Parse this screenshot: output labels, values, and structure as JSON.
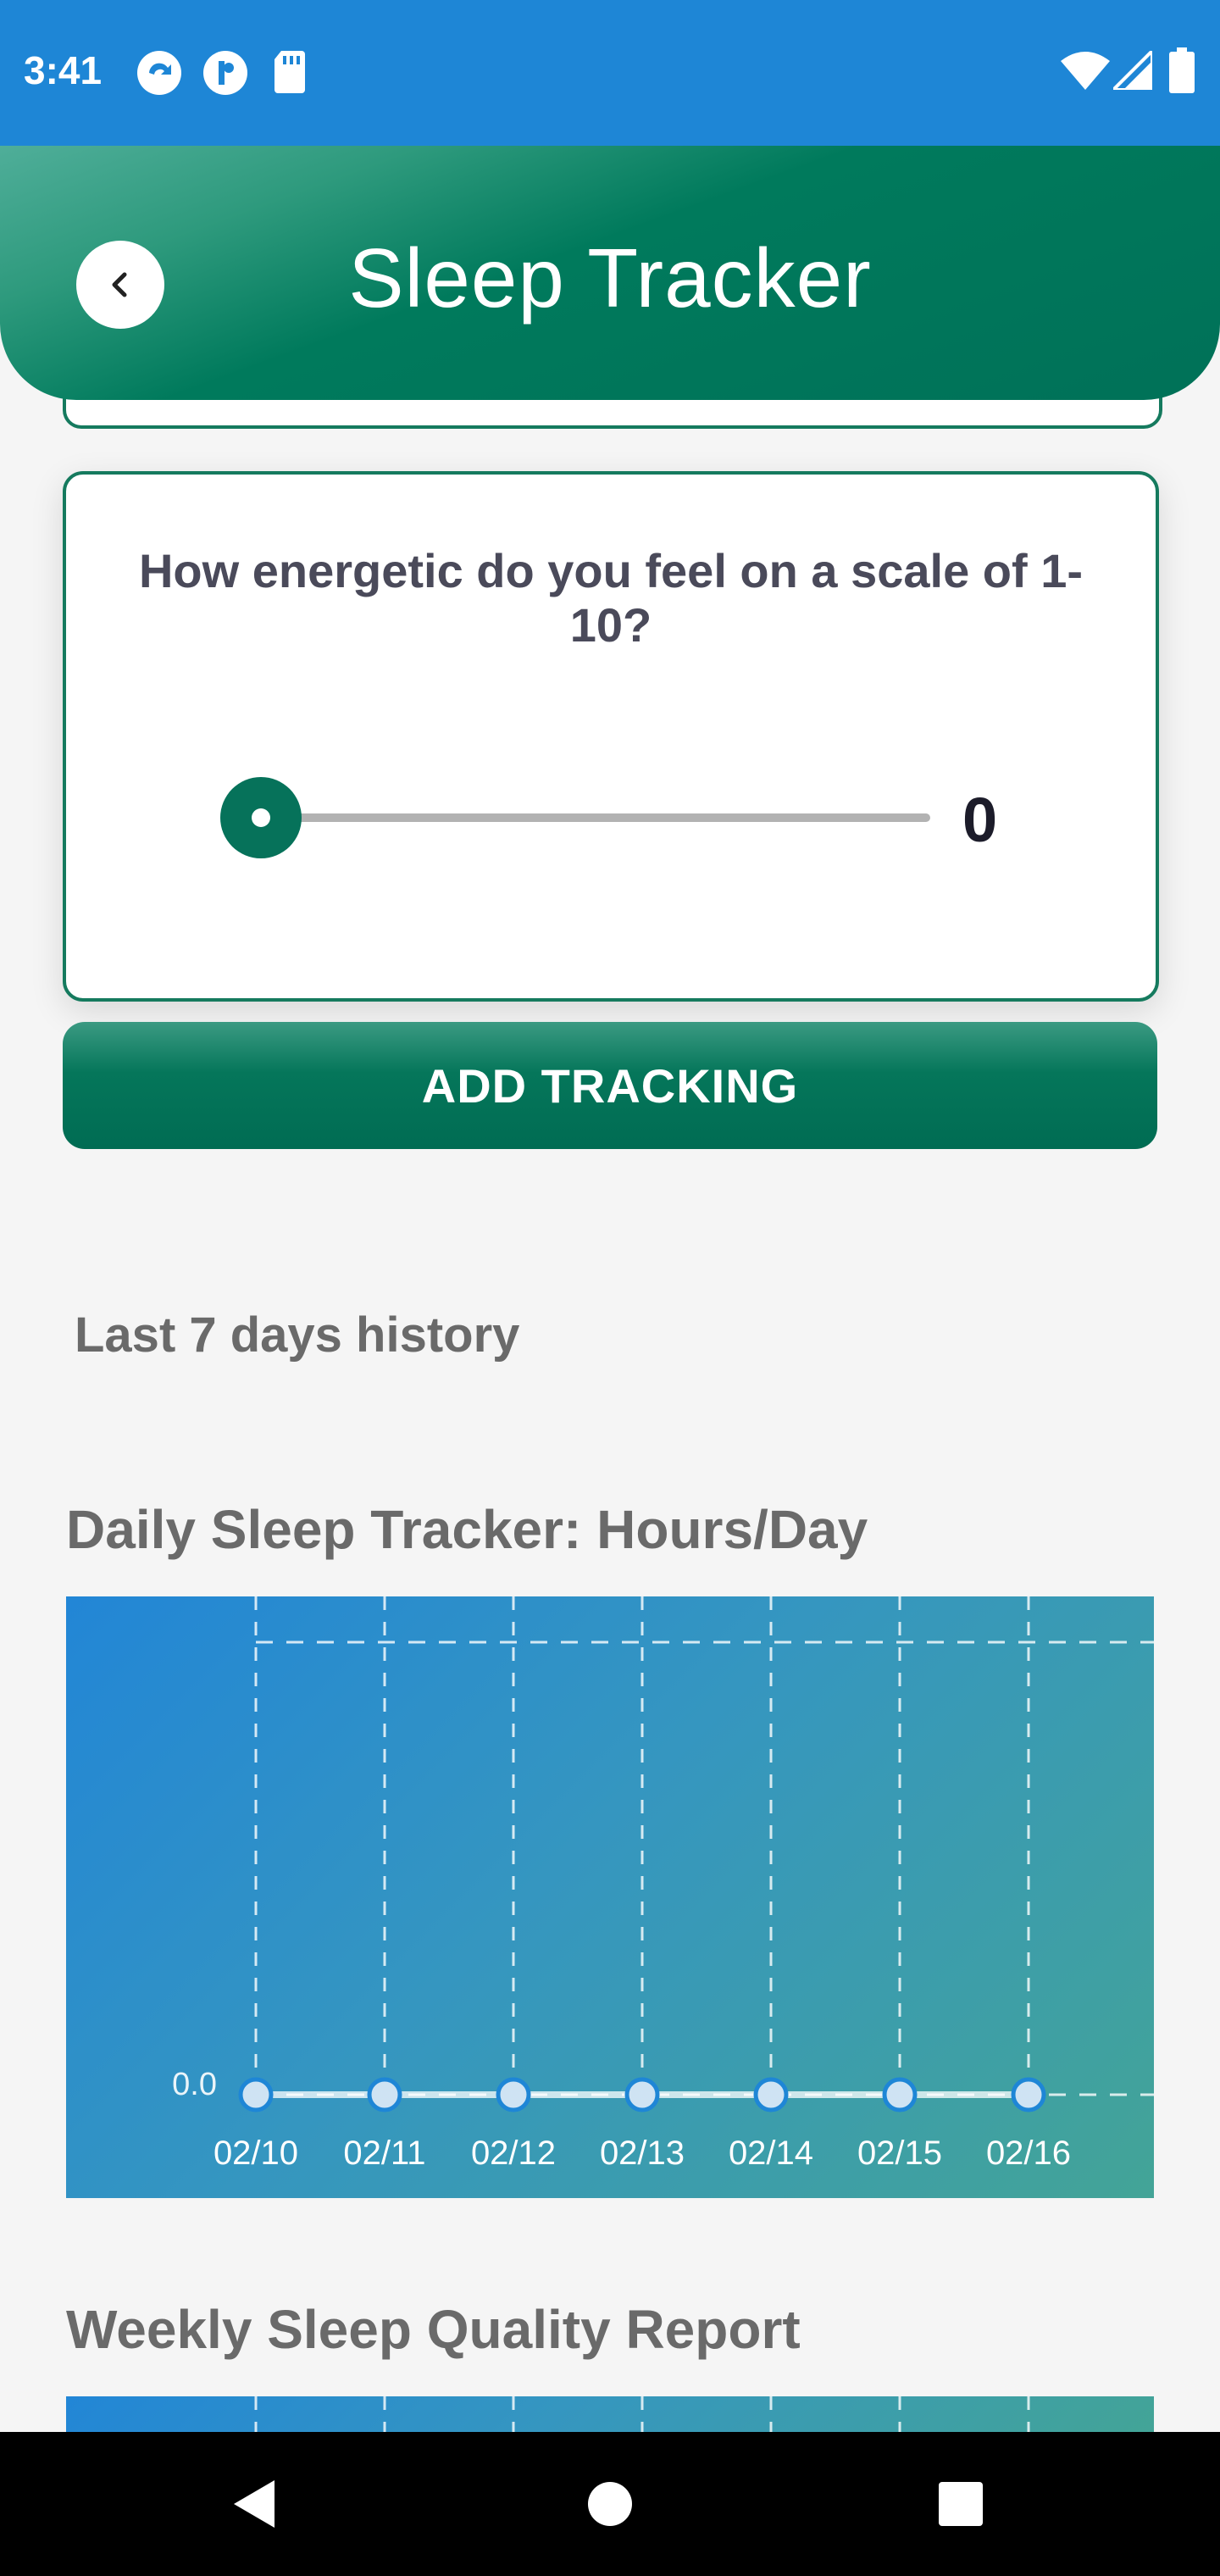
{
  "status_bar": {
    "time": "3:41"
  },
  "header": {
    "title": "Sleep Tracker"
  },
  "energy_card": {
    "question": "How energetic do you feel on a scale of 1-10?",
    "slider_value": "0",
    "slider_level": 0
  },
  "add_button": {
    "label": "ADD TRACKING"
  },
  "history": {
    "title": "Last 7 days history"
  },
  "colors": {
    "primary": "#007158",
    "status_bar": "#1e86d6",
    "chart_start": "#2286d6",
    "chart_end": "#43a497"
  },
  "charts": {
    "daily_title": "Daily Sleep Tracker: Hours/Day",
    "weekly_title": "Weekly Sleep Quality Report"
  },
  "chart_data": [
    {
      "type": "line",
      "title": "Daily Sleep Tracker: Hours/Day",
      "categories": [
        "02/10",
        "02/11",
        "02/12",
        "02/13",
        "02/14",
        "02/15",
        "02/16"
      ],
      "values": [
        0,
        0,
        0,
        0,
        0,
        0,
        0
      ],
      "y_tick_labels": [
        "0.0"
      ],
      "grid": true
    }
  ]
}
